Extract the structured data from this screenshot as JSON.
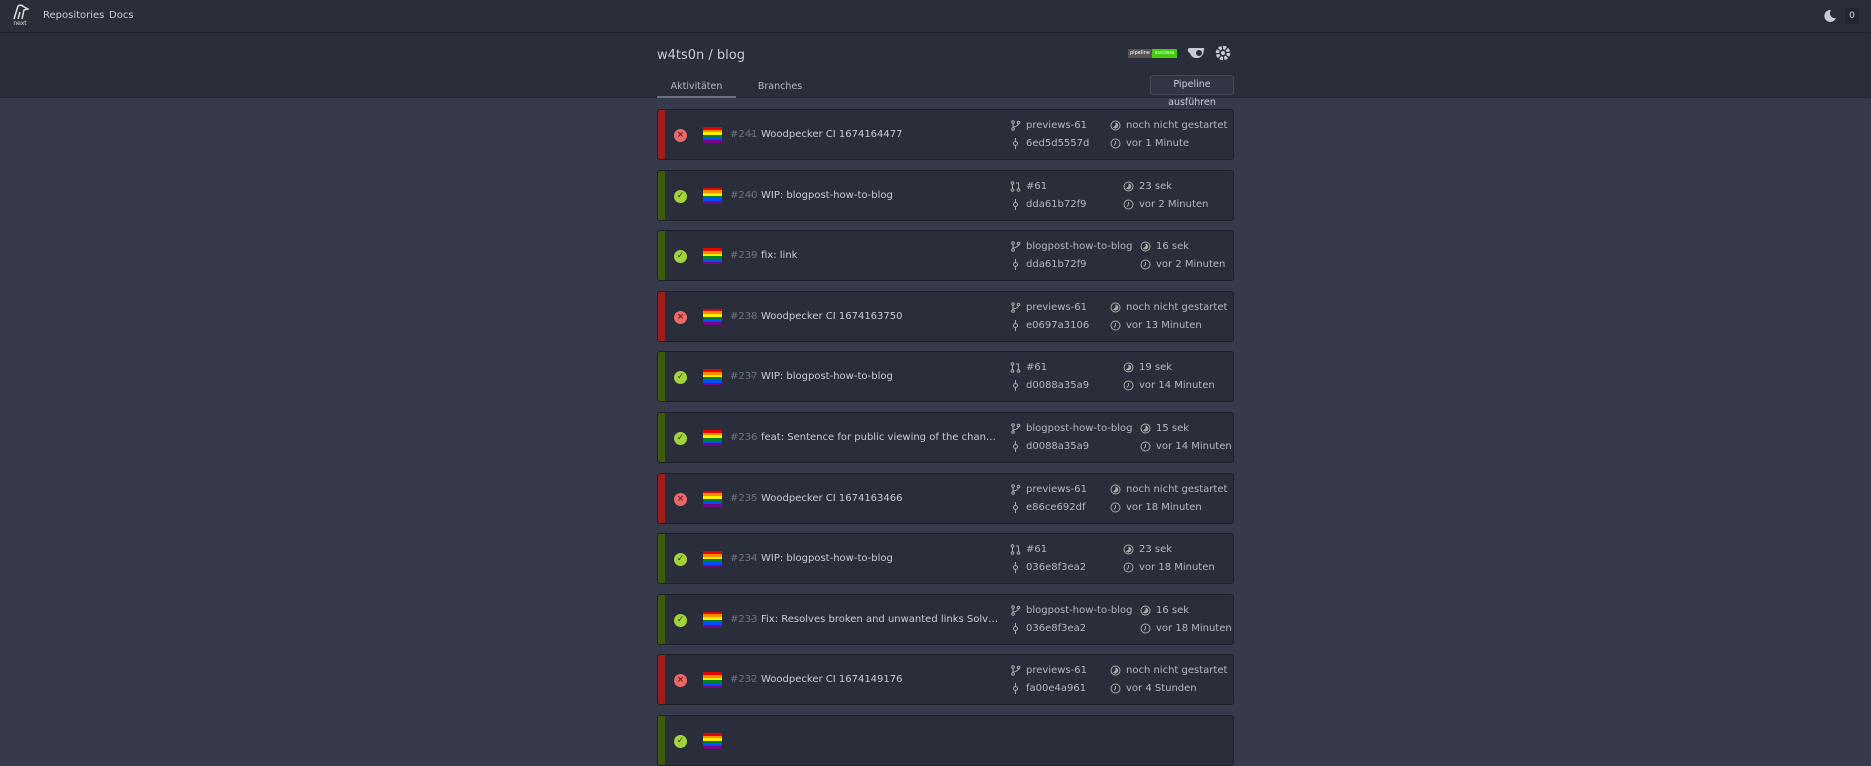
{
  "topbar": {
    "logo_text": "next",
    "nav": [
      "Repositories",
      "Docs"
    ],
    "notification_count": "0"
  },
  "header": {
    "title": "w4ts0n / blog",
    "badge": {
      "label": "pipeline",
      "status": "success"
    },
    "tabs": [
      "Aktivitäten",
      "Branches"
    ],
    "run_button": "Pipeline ausführen"
  },
  "colors": {
    "failure": "#9e1c1c",
    "success": "#3d5a0c",
    "failure_icon": "#e96a6a",
    "success_icon": "#a3d33c"
  },
  "pipelines": [
    {
      "status": "failure",
      "number": "#241",
      "message": "Woodpecker CI 1674164477",
      "ref_type": "branch",
      "ref": "previews-61",
      "commit": "6ed5d5557d",
      "duration": "noch nicht gestartet",
      "since": "vor 1 Minute"
    },
    {
      "status": "success",
      "number": "#240",
      "message": "WIP: blogpost-how-to-blog",
      "ref_type": "pull-request",
      "ref": "#61",
      "commit": "dda61b72f9",
      "duration": "23 sek",
      "since": "vor 2 Minuten"
    },
    {
      "status": "success",
      "number": "#239",
      "message": "fix: link",
      "ref_type": "branch",
      "ref": "blogpost-how-to-blog",
      "commit": "dda61b72f9",
      "duration": "16 sek",
      "since": "vor 2 Minuten"
    },
    {
      "status": "failure",
      "number": "#238",
      "message": "Woodpecker CI 1674163750",
      "ref_type": "branch",
      "ref": "previews-61",
      "commit": "e0697a3106",
      "duration": "noch nicht gestartet",
      "since": "vor 13 Minuten"
    },
    {
      "status": "success",
      "number": "#237",
      "message": "WIP: blogpost-how-to-blog",
      "ref_type": "pull-request",
      "ref": "#61",
      "commit": "d0088a35a9",
      "duration": "19 sek",
      "since": "vor 14 Minuten"
    },
    {
      "status": "success",
      "number": "#236",
      "message": "feat: Sentence for public viewing of the change history",
      "ref_type": "branch",
      "ref": "blogpost-how-to-blog",
      "commit": "d0088a35a9",
      "duration": "15 sek",
      "since": "vor 14 Minuten"
    },
    {
      "status": "failure",
      "number": "#235",
      "message": "Woodpecker CI 1674163466",
      "ref_type": "branch",
      "ref": "previews-61",
      "commit": "e86ce692df",
      "duration": "noch nicht gestartet",
      "since": "vor 18 Minuten"
    },
    {
      "status": "success",
      "number": "#234",
      "message": "WIP: blogpost-how-to-blog",
      "ref_type": "pull-request",
      "ref": "#61",
      "commit": "036e8f3ea2",
      "duration": "23 sek",
      "since": "vor 18 Minuten"
    },
    {
      "status": "success",
      "number": "#233",
      "message": "Fix: Resolves broken and unwanted links Solves https://cod...",
      "ref_type": "branch",
      "ref": "blogpost-how-to-blog",
      "commit": "036e8f3ea2",
      "duration": "16 sek",
      "since": "vor 18 Minuten"
    },
    {
      "status": "failure",
      "number": "#232",
      "message": "Woodpecker CI 1674149176",
      "ref_type": "branch",
      "ref": "previews-61",
      "commit": "fa00e4a961",
      "duration": "noch nicht gestartet",
      "since": "vor 4 Stunden"
    },
    {
      "status": "success",
      "number": "",
      "message": "",
      "ref_type": "",
      "ref": "",
      "commit": "",
      "duration": "",
      "since": ""
    }
  ]
}
